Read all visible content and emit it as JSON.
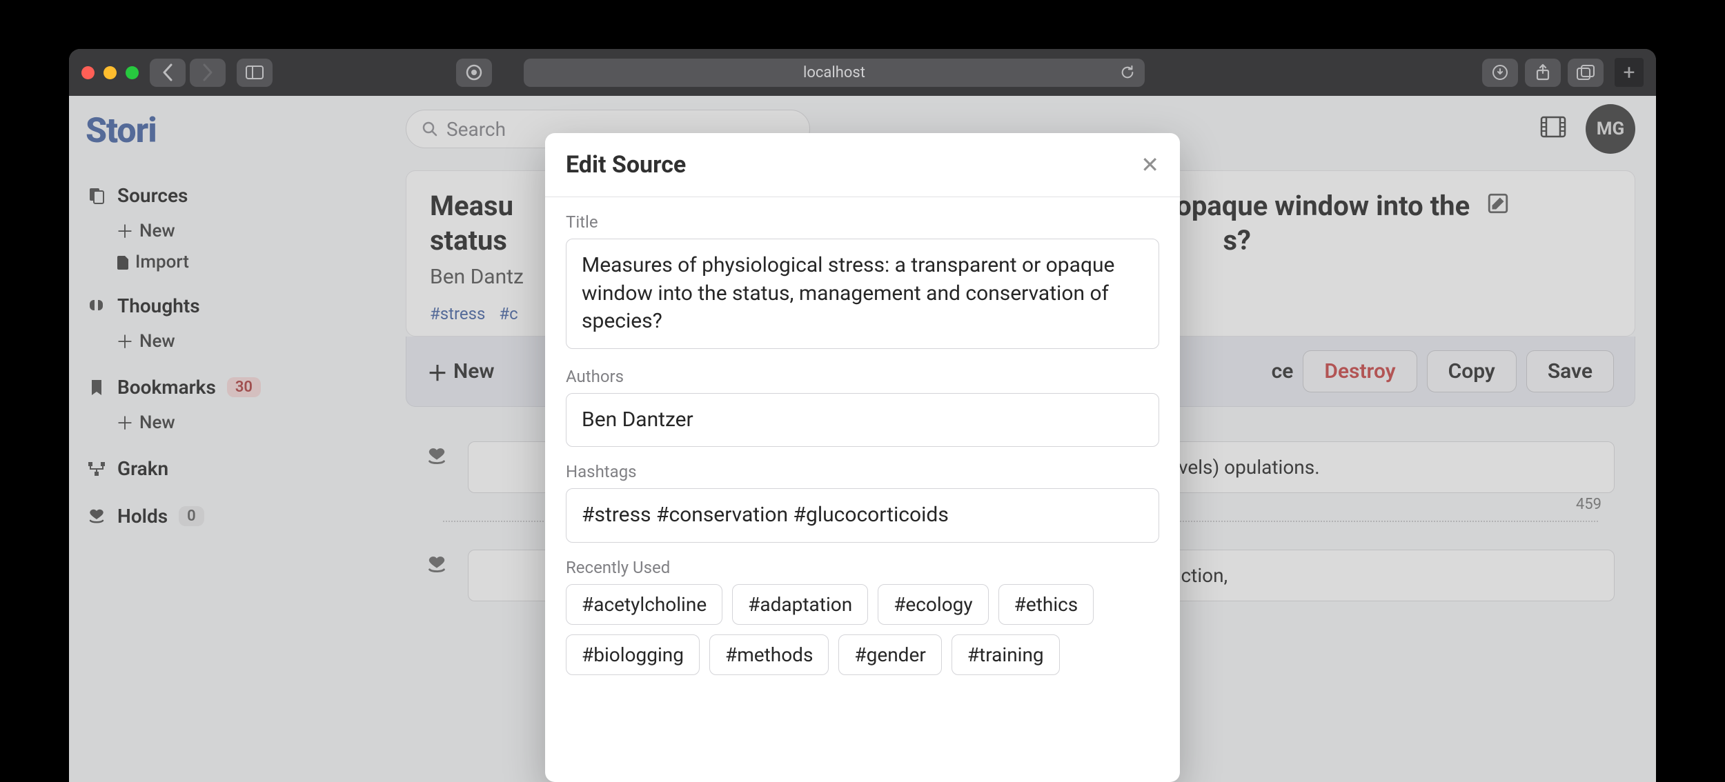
{
  "browser": {
    "address": "localhost"
  },
  "app": {
    "logo": "Stori",
    "avatar_initials": "MG",
    "search_placeholder": "Search"
  },
  "sidebar": {
    "sources_label": "Sources",
    "sources_new": "New",
    "sources_import": "Import",
    "thoughts_label": "Thoughts",
    "thoughts_new": "New",
    "bookmarks_label": "Bookmarks",
    "bookmarks_count": "30",
    "bookmarks_new": "New",
    "grakn_label": "Grakn",
    "holds_label": "Holds",
    "holds_count": "0"
  },
  "source": {
    "title": "Measures of physiological stress: a transparent or opaque window into the status, management and conservation of species?",
    "title_bg_left": "Measu",
    "title_bg_right": "r opaque window into the",
    "title_bg_line2_left": "status",
    "title_bg_line2_right": "s?",
    "author_bg": "Ben Dantz",
    "tags": {
      "t0": "#stress",
      "t1": "#c"
    }
  },
  "actions": {
    "newnote_label": "New",
    "source_right_label": "ce",
    "destroy": "Destroy",
    "copy": "Copy",
    "save": "Save"
  },
  "notes": {
    "n0": {
      "text": "gical stress (glucocorticoid levels) opulations.",
      "count": "459"
    },
    "n1": {
      "text": "ffects on survival and reproduction,"
    }
  },
  "modal": {
    "heading": "Edit Source",
    "title_label": "Title",
    "title_value": "Measures of physiological stress: a transparent or opaque window into the status, management and conservation of species?",
    "authors_label": "Authors",
    "authors_value": "Ben Dantzer",
    "hashtags_label": "Hashtags",
    "hashtags_value": "#stress #conservation #glucocorticoids",
    "recent_label": "Recently Used",
    "recent": {
      "r0": "#acetylcholine",
      "r1": "#adaptation",
      "r2": "#ecology",
      "r3": "#ethics",
      "r4": "#biologging",
      "r5": "#methods",
      "r6": "#gender",
      "r7": "#training"
    }
  }
}
